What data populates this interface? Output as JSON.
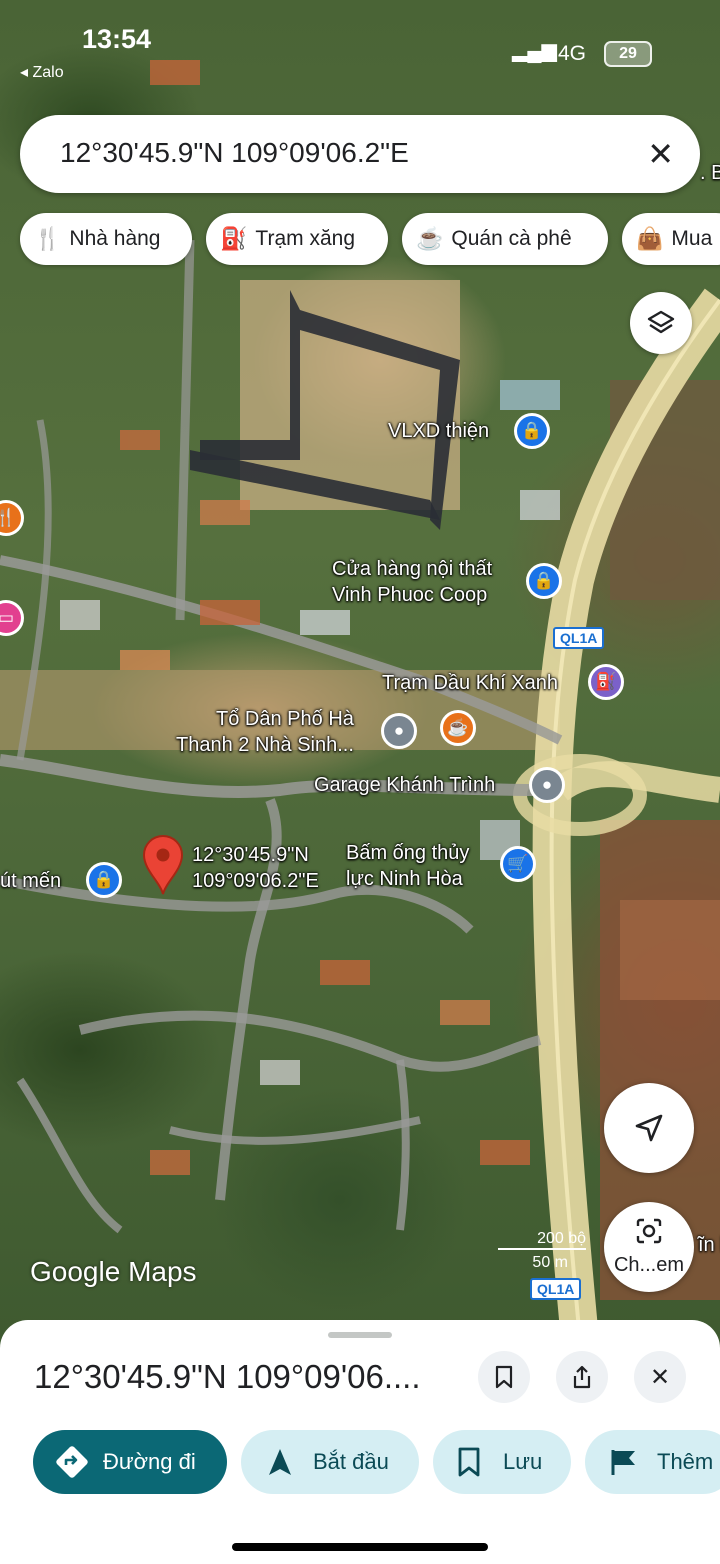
{
  "status_bar": {
    "time": "13:54",
    "back_app": "Zalo",
    "network": "4G",
    "battery": "29"
  },
  "search": {
    "query": "12°30'45.9\"N 109°09'06.2\"E"
  },
  "chips": [
    {
      "label": "Nhà hàng",
      "icon": "fork-knife-icon"
    },
    {
      "label": "Trạm xăng",
      "icon": "gas-station-icon"
    },
    {
      "label": "Quán cà phê",
      "icon": "coffee-cup-icon"
    },
    {
      "label": "Mua",
      "icon": "shopping-bag-icon"
    }
  ],
  "map": {
    "pois": [
      {
        "name": "VLXD thiện"
      },
      {
        "name": "Cửa hàng nội thất\nVinh Phuoc Coop"
      },
      {
        "name": "Trạm Dầu Khí Xanh"
      },
      {
        "name": "Tổ Dân Phố Hà\nThanh 2 Nhà Sinh..."
      },
      {
        "name": "Garage Khánh Trình"
      },
      {
        "name": "Bấm ống thủy\nlực Ninh Hòa"
      },
      {
        "name": "út mến"
      },
      {
        "name": "ĩn lạ"
      },
      {
        "name": ". B"
      }
    ],
    "dropped_pin_label": "12°30'45.9\"N\n109°09'06.2\"E",
    "road_shields": [
      "QL1A",
      "QL1A"
    ],
    "scale": {
      "upper": "200 bộ",
      "lower": "50 m"
    },
    "logo": "Google Maps",
    "lens_label": "Ch...em"
  },
  "sheet": {
    "title": "12°30'45.9\"N 109°09'06....",
    "actions": [
      {
        "label": "Đường đi",
        "icon": "directions-icon"
      },
      {
        "label": "Bắt đầu",
        "icon": "navigation-arrow-icon"
      },
      {
        "label": "Lưu",
        "icon": "bookmark-icon"
      },
      {
        "label": "Thêm",
        "icon": "flag-icon"
      }
    ]
  }
}
